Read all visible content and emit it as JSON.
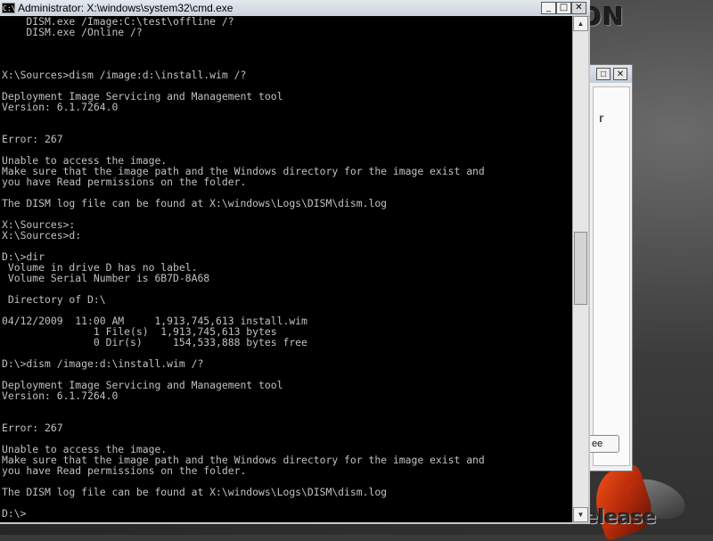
{
  "desktop": {
    "logo_top": "ION",
    "logo_bottom": "elease"
  },
  "background_window": {
    "button_label": "ee"
  },
  "window": {
    "title": "Administrator: X:\\windows\\system32\\cmd.exe",
    "icon_label": "C:\\",
    "minimize_glyph": "_",
    "maximize_glyph": "□",
    "close_glyph": "✕"
  },
  "console": {
    "text": "    DISM.exe /Image:C:\\test\\offline /?\n    DISM.exe /Online /?\n\n\n\nX:\\Sources>dism /image:d:\\install.wim /?\n\nDeployment Image Servicing and Management tool\nVersion: 6.1.7264.0\n\n\nError: 267\n\nUnable to access the image.\nMake sure that the image path and the Windows directory for the image exist and\nyou have Read permissions on the folder.\n\nThe DISM log file can be found at X:\\windows\\Logs\\DISM\\dism.log\n\nX:\\Sources>:\nX:\\Sources>d:\n\nD:\\>dir\n Volume in drive D has no label.\n Volume Serial Number is 6B7D-8A68\n\n Directory of D:\\\n\n04/12/2009  11:00 AM     1,913,745,613 install.wim\n               1 File(s)  1,913,745,613 bytes\n               0 Dir(s)     154,533,888 bytes free\n\nD:\\>dism /image:d:\\install.wim /?\n\nDeployment Image Servicing and Management tool\nVersion: 6.1.7264.0\n\n\nError: 267\n\nUnable to access the image.\nMake sure that the image path and the Windows directory for the image exist and\nyou have Read permissions on the folder.\n\nThe DISM log file can be found at X:\\windows\\Logs\\DISM\\dism.log\n\nD:\\>"
  },
  "scrollbar": {
    "up_glyph": "▲",
    "down_glyph": "▼",
    "position_fraction": 0.55
  },
  "colors": {
    "console_bg": "#000000",
    "console_fg": "#c0c0c0"
  }
}
